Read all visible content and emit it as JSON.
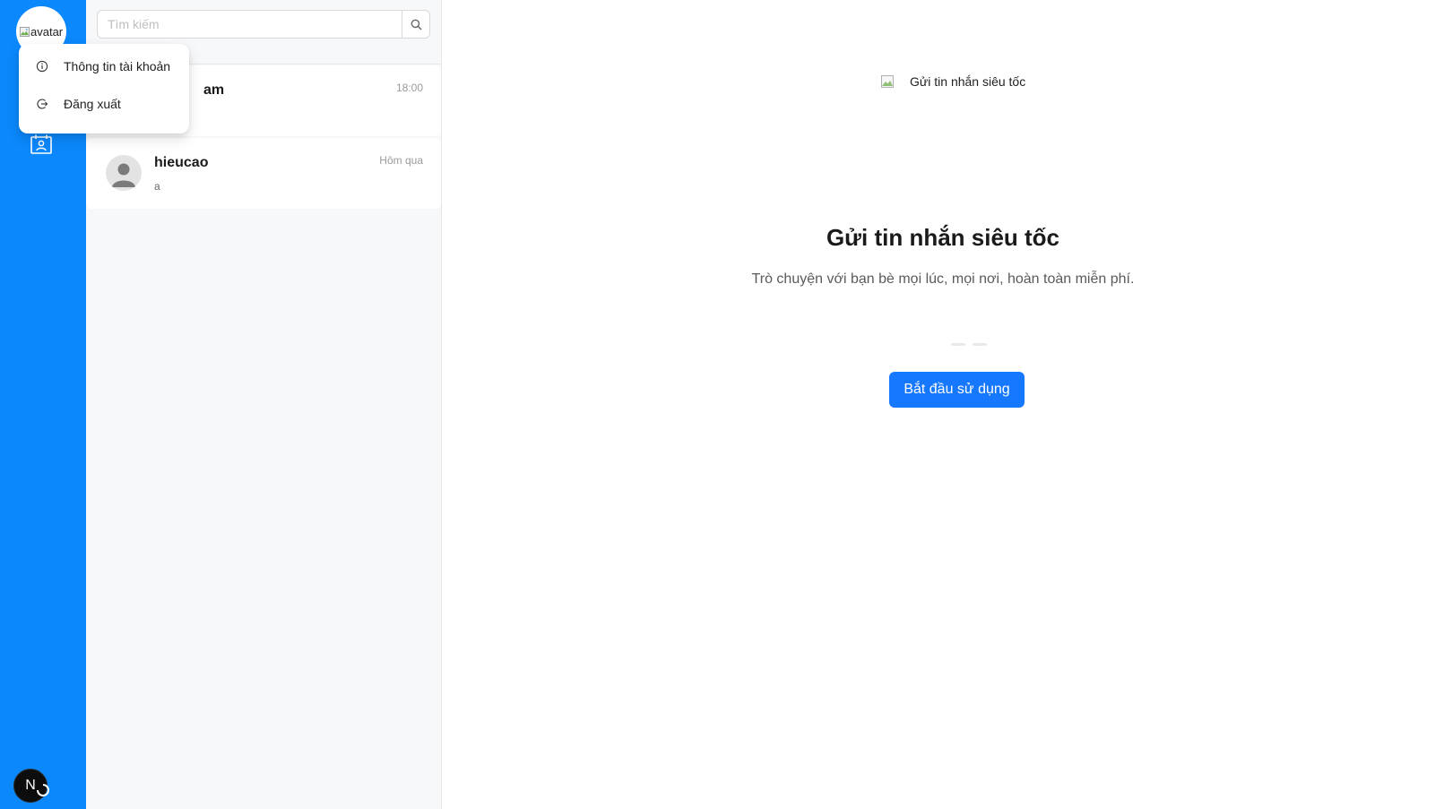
{
  "rail": {
    "avatar_alt": "avatar",
    "next_badge": "N"
  },
  "account_menu": {
    "items": [
      {
        "label": "Thông tin tài khoản",
        "icon": "info-circle-icon"
      },
      {
        "label": "Đăng xuất",
        "icon": "logout-icon"
      }
    ]
  },
  "search": {
    "placeholder": "Tìm kiếm",
    "value": ""
  },
  "conversations": [
    {
      "name": "am",
      "last_message": "",
      "time": "18:00"
    },
    {
      "name": "hieucao",
      "last_message": "a",
      "time": "Hôm qua"
    }
  ],
  "welcome": {
    "image_alt": "Gửi tin nhắn siêu tốc",
    "title": "Gửi tin nhắn siêu tốc",
    "subtitle": "Trò chuyện với bạn bè mọi lúc, mọi nơi, hoàn toàn miễn phí.",
    "start_button": "Bắt đầu sử dụng"
  },
  "colors": {
    "rail": "#0b88fb",
    "primary_button": "#1677ff",
    "list_background": "#f7f8fa"
  }
}
